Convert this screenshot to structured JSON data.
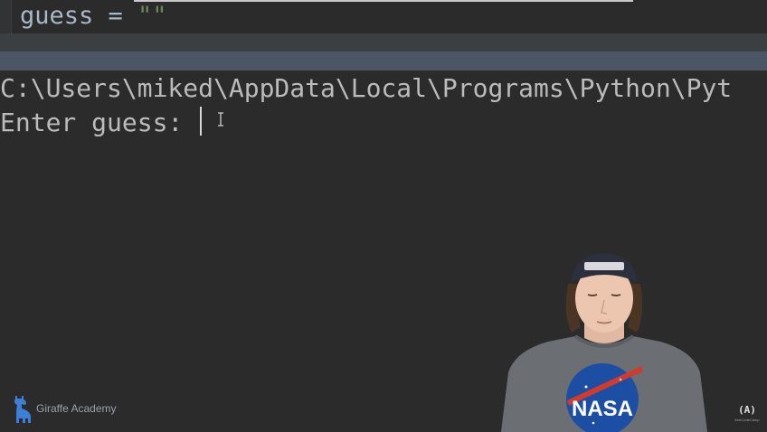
{
  "editor": {
    "code_text": "guess = ",
    "code_string": "\"\""
  },
  "console": {
    "path_line": "C:\\Users\\miked\\AppData\\Local\\Programs\\Python\\Pyt",
    "prompt_line": "Enter guess: "
  },
  "overlay": {
    "channel_name": "Giraffe Academy",
    "shirt_text": "NASA",
    "logo_glyph": "(A)",
    "logo_caption": "freeCodeCamp"
  },
  "colors": {
    "background": "#2b2b2b",
    "console_text": "#bbbbbb",
    "code_text": "#a9b7c6",
    "string_green": "#6a8759",
    "run_tab_bar": "#4b5564",
    "brand_blue": "#3d7fd6"
  },
  "icons": [
    "giraffe-icon",
    "text-cursor-icon",
    "freecodecamp-icon"
  ]
}
